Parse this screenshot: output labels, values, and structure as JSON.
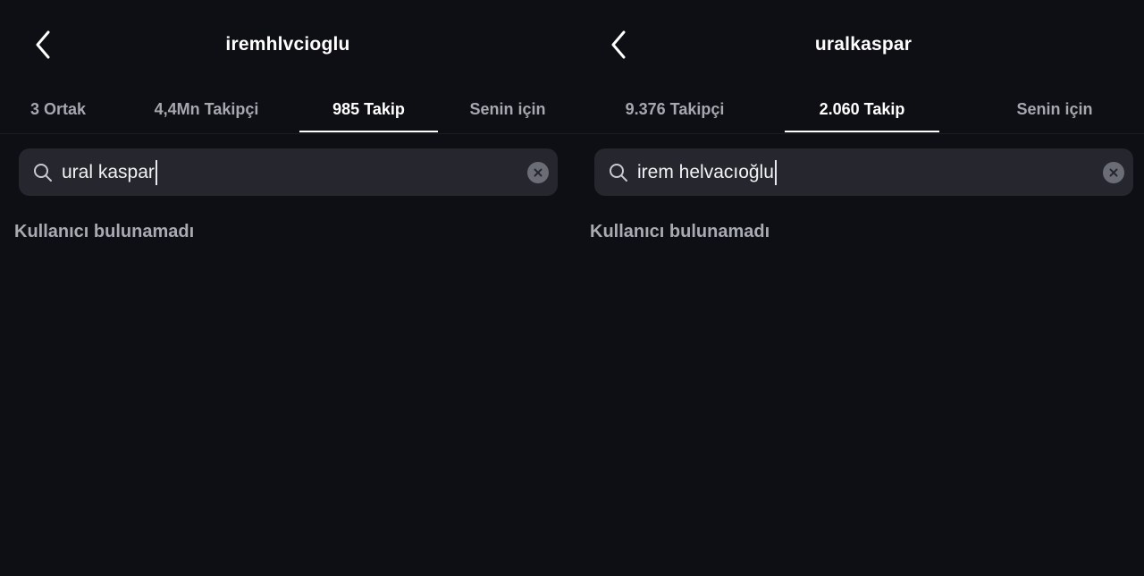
{
  "left": {
    "title": "iremhlvcioglu",
    "tabs": [
      {
        "label": "3 Ortak"
      },
      {
        "label": "4,4Mn Takipçi"
      },
      {
        "label": "985 Takip"
      },
      {
        "label": "Senin için"
      }
    ],
    "active_tab": "985 Takip",
    "search": {
      "value": "ural kaspar"
    },
    "empty_message": "Kullanıcı bulunamadı"
  },
  "right": {
    "title": "uralkaspar",
    "tabs": [
      {
        "label": "9.376 Takipçi"
      },
      {
        "label": "2.060 Takip"
      },
      {
        "label": "Senin için"
      }
    ],
    "active_tab": "2.060 Takip",
    "search": {
      "value": "irem helvacıoğlu"
    },
    "empty_message": "Kullanıcı bulunamadı"
  },
  "icons": {
    "back": "chevron-left-icon",
    "search": "search-icon",
    "clear": "clear-circle-icon"
  },
  "colors": {
    "background": "#0e0f14",
    "search_field": "#26272e",
    "active_text": "#ffffff",
    "inactive_text": "#a6a8b0"
  }
}
